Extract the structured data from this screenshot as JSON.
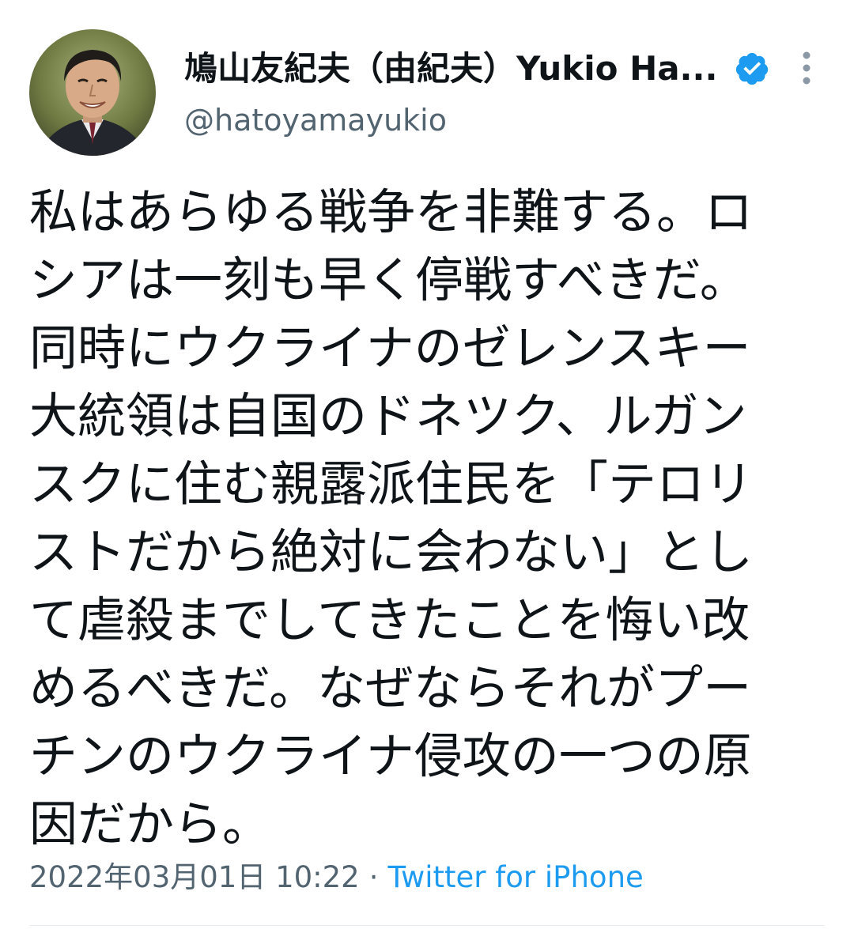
{
  "author": {
    "display_name": "鳩山友紀夫（由紀夫）Yukio Ha...",
    "handle": "@hatoyamayukio",
    "verified": true,
    "avatar_icon": "profile-photo"
  },
  "tweet": {
    "lines": [
      "私はあらゆる戦争を非難する。ロ",
      "シアは一刻も早く停戦すべきだ。",
      "同時にウクライナのゼレンスキー",
      "大統領は自国のドネツク、ルガン",
      "スクに住む親露派住民を「テロリ",
      "ストだから絶対に会わない」とし",
      "て虐殺までしてきたことを悔い改",
      "めるべきだ。なぜならそれがプー",
      "チンのウクライナ侵攻の一つの原",
      "因だから。"
    ],
    "timestamp": "2022年03月01日 10:22",
    "separator": "·",
    "source": "Twitter for iPhone"
  },
  "colors": {
    "text_primary": "#0f1419",
    "text_secondary": "#536471",
    "accent": "#1d9bf0"
  }
}
